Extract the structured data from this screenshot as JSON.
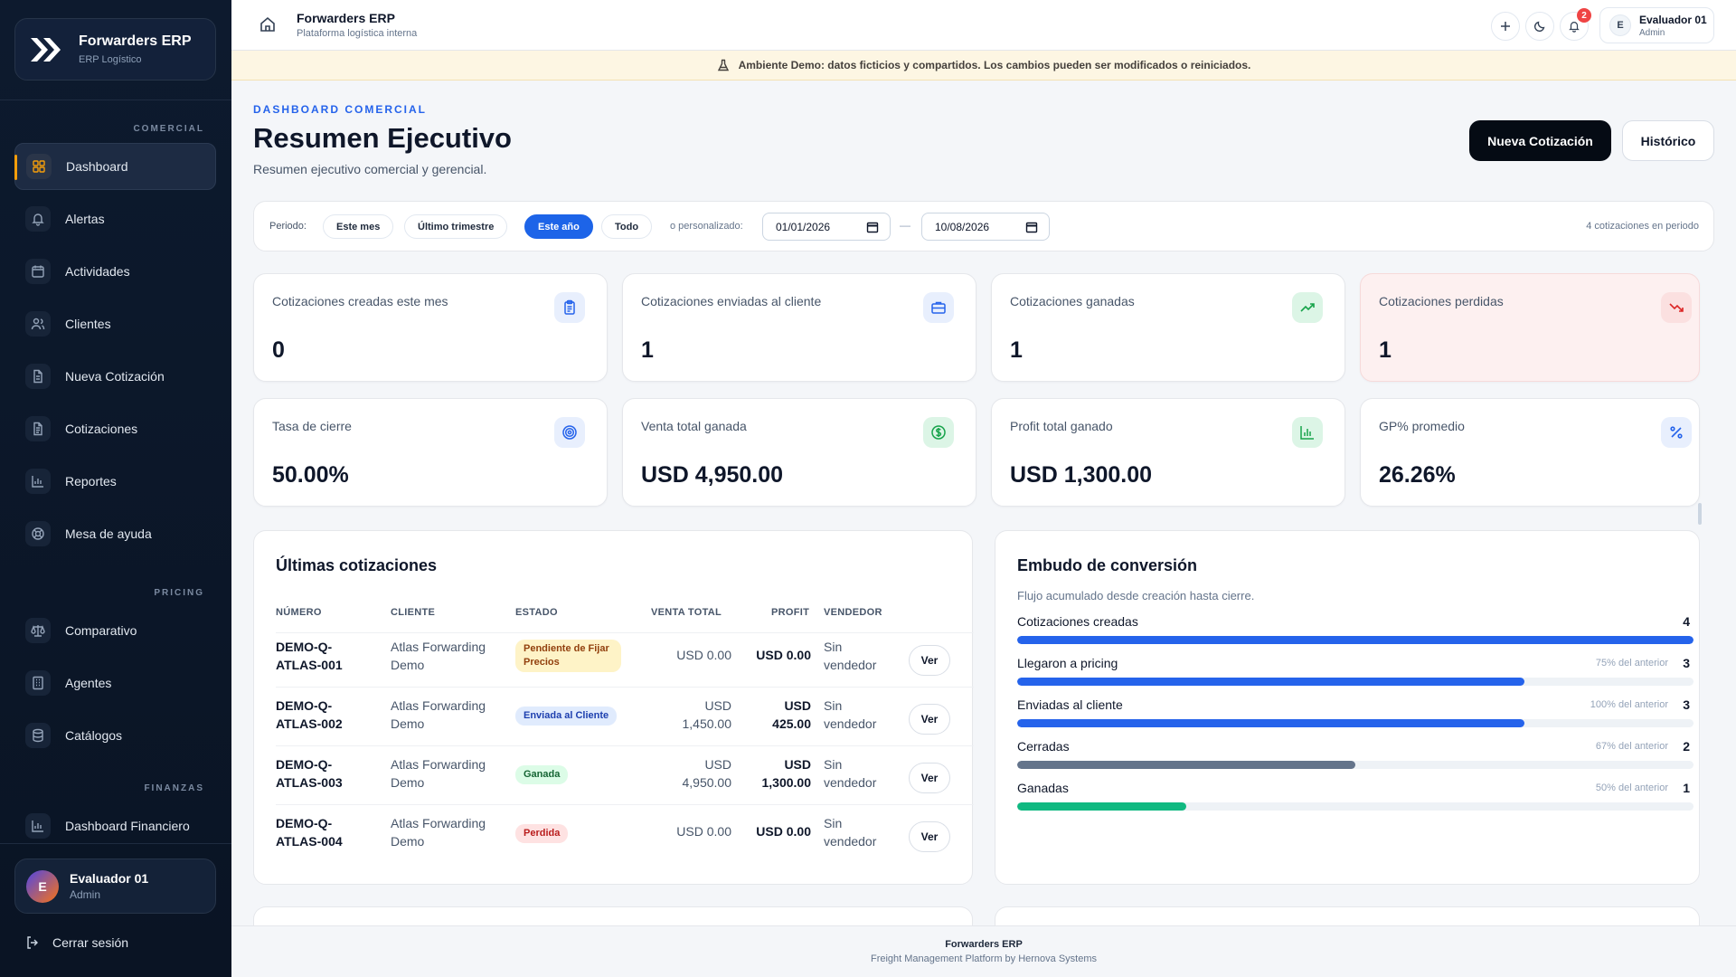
{
  "brand": {
    "title": "Forwarders ERP",
    "subtitle": "ERP Logístico"
  },
  "sidebar": {
    "sections": {
      "comercial": "COMERCIAL",
      "pricing": "PRICING",
      "finanzas": "FINANZAS"
    },
    "items": [
      {
        "label": "Dashboard",
        "icon": "grid-icon",
        "active": true
      },
      {
        "label": "Alertas",
        "icon": "bell-icon"
      },
      {
        "label": "Actividades",
        "icon": "calendar-icon"
      },
      {
        "label": "Clientes",
        "icon": "users-icon"
      },
      {
        "label": "Nueva Cotización",
        "icon": "file-icon"
      },
      {
        "label": "Cotizaciones",
        "icon": "file-text-icon"
      },
      {
        "label": "Reportes",
        "icon": "bar-chart-icon"
      },
      {
        "label": "Mesa de ayuda",
        "icon": "lifebuoy-icon"
      },
      {
        "label": "Comparativo",
        "icon": "scale-icon"
      },
      {
        "label": "Agentes",
        "icon": "building-icon"
      },
      {
        "label": "Catálogos",
        "icon": "database-icon"
      },
      {
        "label": "Dashboard Financiero",
        "icon": "bar-chart-icon"
      }
    ],
    "user": {
      "initial": "E",
      "name": "Evaluador 01",
      "role": "Admin"
    },
    "logout": "Cerrar sesión"
  },
  "header": {
    "title": "Forwarders ERP",
    "subtitle": "Plataforma logística interna",
    "notifications": "2",
    "user": {
      "initial": "E",
      "name": "Evaluador 01",
      "role": "Admin"
    }
  },
  "banner": "Ambiente Demo: datos ficticios y compartidos. Los cambios pueden ser modificados o reiniciados.",
  "page": {
    "eyebrow": "DASHBOARD COMERCIAL",
    "title": "Resumen Ejecutivo",
    "subtitle": "Resumen ejecutivo comercial y gerencial.",
    "primary_button": "Nueva Cotización",
    "secondary_button": "Histórico"
  },
  "period": {
    "label": "Periodo:",
    "options": [
      "Este mes",
      "Último trimestre",
      "Este año",
      "Todo"
    ],
    "selected": "Este año",
    "custom_label": "o personalizado:",
    "date_from": "01/01/2026",
    "date_to": "10/08/2026",
    "separator": "—",
    "count": "4 cotizaciones en periodo"
  },
  "kpis": [
    {
      "label": "Cotizaciones creadas este mes",
      "value": "0",
      "icon": "clipboard-icon",
      "color": "#2563eb"
    },
    {
      "label": "Cotizaciones enviadas al cliente",
      "value": "1",
      "icon": "briefcase-icon",
      "color": "#2563eb"
    },
    {
      "label": "Cotizaciones ganadas",
      "value": "1",
      "icon": "trending-up-icon",
      "color": "#16a34a"
    },
    {
      "label": "Cotizaciones perdidas",
      "value": "1",
      "icon": "trending-down-icon",
      "color": "#dc2626"
    },
    {
      "label": "Tasa de cierre",
      "value": "50.00%",
      "icon": "target-icon",
      "color": "#2563eb"
    },
    {
      "label": "Venta total ganada",
      "value": "USD 4,950.00",
      "icon": "dollar-icon",
      "color": "#16a34a"
    },
    {
      "label": "Profit total ganado",
      "value": "USD 1,300.00",
      "icon": "bar-chart-icon",
      "color": "#16a34a"
    },
    {
      "label": "GP% promedio",
      "value": "26.26%",
      "icon": "percent-icon",
      "color": "#2563eb"
    }
  ],
  "quotes": {
    "title": "Últimas cotizaciones",
    "columns": [
      "NÚMERO",
      "CLIENTE",
      "ESTADO",
      "VENTA TOTAL",
      "PROFIT",
      "VENDEDOR"
    ],
    "action_label": "Ver",
    "rows": [
      {
        "number": [
          "DEMO-Q-",
          "ATLAS-001"
        ],
        "client": [
          "Atlas Forwarding",
          "Demo"
        ],
        "status": [
          "Pendiente de Fijar",
          "Precios"
        ],
        "status_type": "pending",
        "sale": [
          "USD 0.00"
        ],
        "profit": [
          "USD 0.00"
        ],
        "seller": [
          "Sin",
          "vendedor"
        ]
      },
      {
        "number": [
          "DEMO-Q-",
          "ATLAS-002"
        ],
        "client": [
          "Atlas Forwarding",
          "Demo"
        ],
        "status": [
          "Enviada al Cliente"
        ],
        "status_type": "sent",
        "sale": [
          "USD",
          "1,450.00"
        ],
        "profit": [
          "USD",
          "425.00"
        ],
        "seller": [
          "Sin",
          "vendedor"
        ]
      },
      {
        "number": [
          "DEMO-Q-",
          "ATLAS-003"
        ],
        "client": [
          "Atlas Forwarding",
          "Demo"
        ],
        "status": [
          "Ganada"
        ],
        "status_type": "won",
        "sale": [
          "USD",
          "4,950.00"
        ],
        "profit": [
          "USD",
          "1,300.00"
        ],
        "seller": [
          "Sin",
          "vendedor"
        ]
      },
      {
        "number": [
          "DEMO-Q-",
          "ATLAS-004"
        ],
        "client": [
          "Atlas Forwarding",
          "Demo"
        ],
        "status": [
          "Perdida"
        ],
        "status_type": "lost",
        "sale": [
          "USD 0.00"
        ],
        "profit": [
          "USD 0.00"
        ],
        "seller": [
          "Sin",
          "vendedor"
        ]
      }
    ]
  },
  "funnel": {
    "title": "Embudo de conversión",
    "subtitle": "Flujo acumulado desde creación hasta cierre.",
    "max": 4,
    "stages": [
      {
        "label": "Cotizaciones creadas",
        "pct": "",
        "count": 4,
        "color": "#2563eb"
      },
      {
        "label": "Llegaron a pricing",
        "pct": "75% del anterior",
        "count": 3,
        "color": "#2563eb"
      },
      {
        "label": "Enviadas al cliente",
        "pct": "100% del anterior",
        "count": 3,
        "color": "#2563eb"
      },
      {
        "label": "Cerradas",
        "pct": "67% del anterior",
        "count": 2,
        "color": "#64748b"
      },
      {
        "label": "Ganadas",
        "pct": "50% del anterior",
        "count": 1,
        "color": "#10b981"
      }
    ]
  },
  "footer": {
    "title": "Forwarders ERP",
    "subtitle": "Freight Management Platform by Hernova Systems"
  }
}
